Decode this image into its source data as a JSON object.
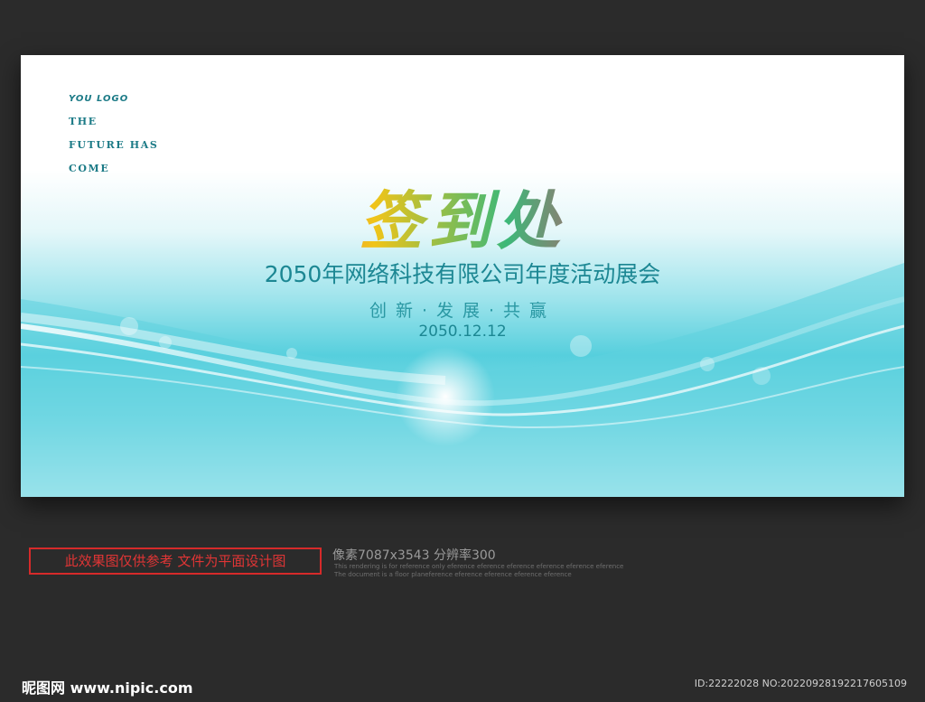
{
  "logo": {
    "brand": "YOU LOGO",
    "line1": "THE",
    "line2": "FUTURE HAS",
    "line3": "COME"
  },
  "banner": {
    "title": "签到处",
    "company": "2050年网络科技有限公司年度活动展会",
    "slogan": "创新·发展·共赢",
    "date": "2050.12.12",
    "colors": {
      "primary_teal": "#1c8793",
      "wave": "#56cfdd",
      "background": "#ffffff"
    }
  },
  "footer": {
    "notice": "此效果图仅供参考 文件为平面设计图",
    "spec": "像素7087x3543  分辨率300",
    "fine_print_1": "This rendering is for reference only  eference eference eference eference eference eference",
    "fine_print_2": "The document is a floor planeference eference eference eference eference",
    "watermark": "昵图网 www.nipic.com",
    "id_text": "ID:22222028 NO:20220928192217605109"
  }
}
